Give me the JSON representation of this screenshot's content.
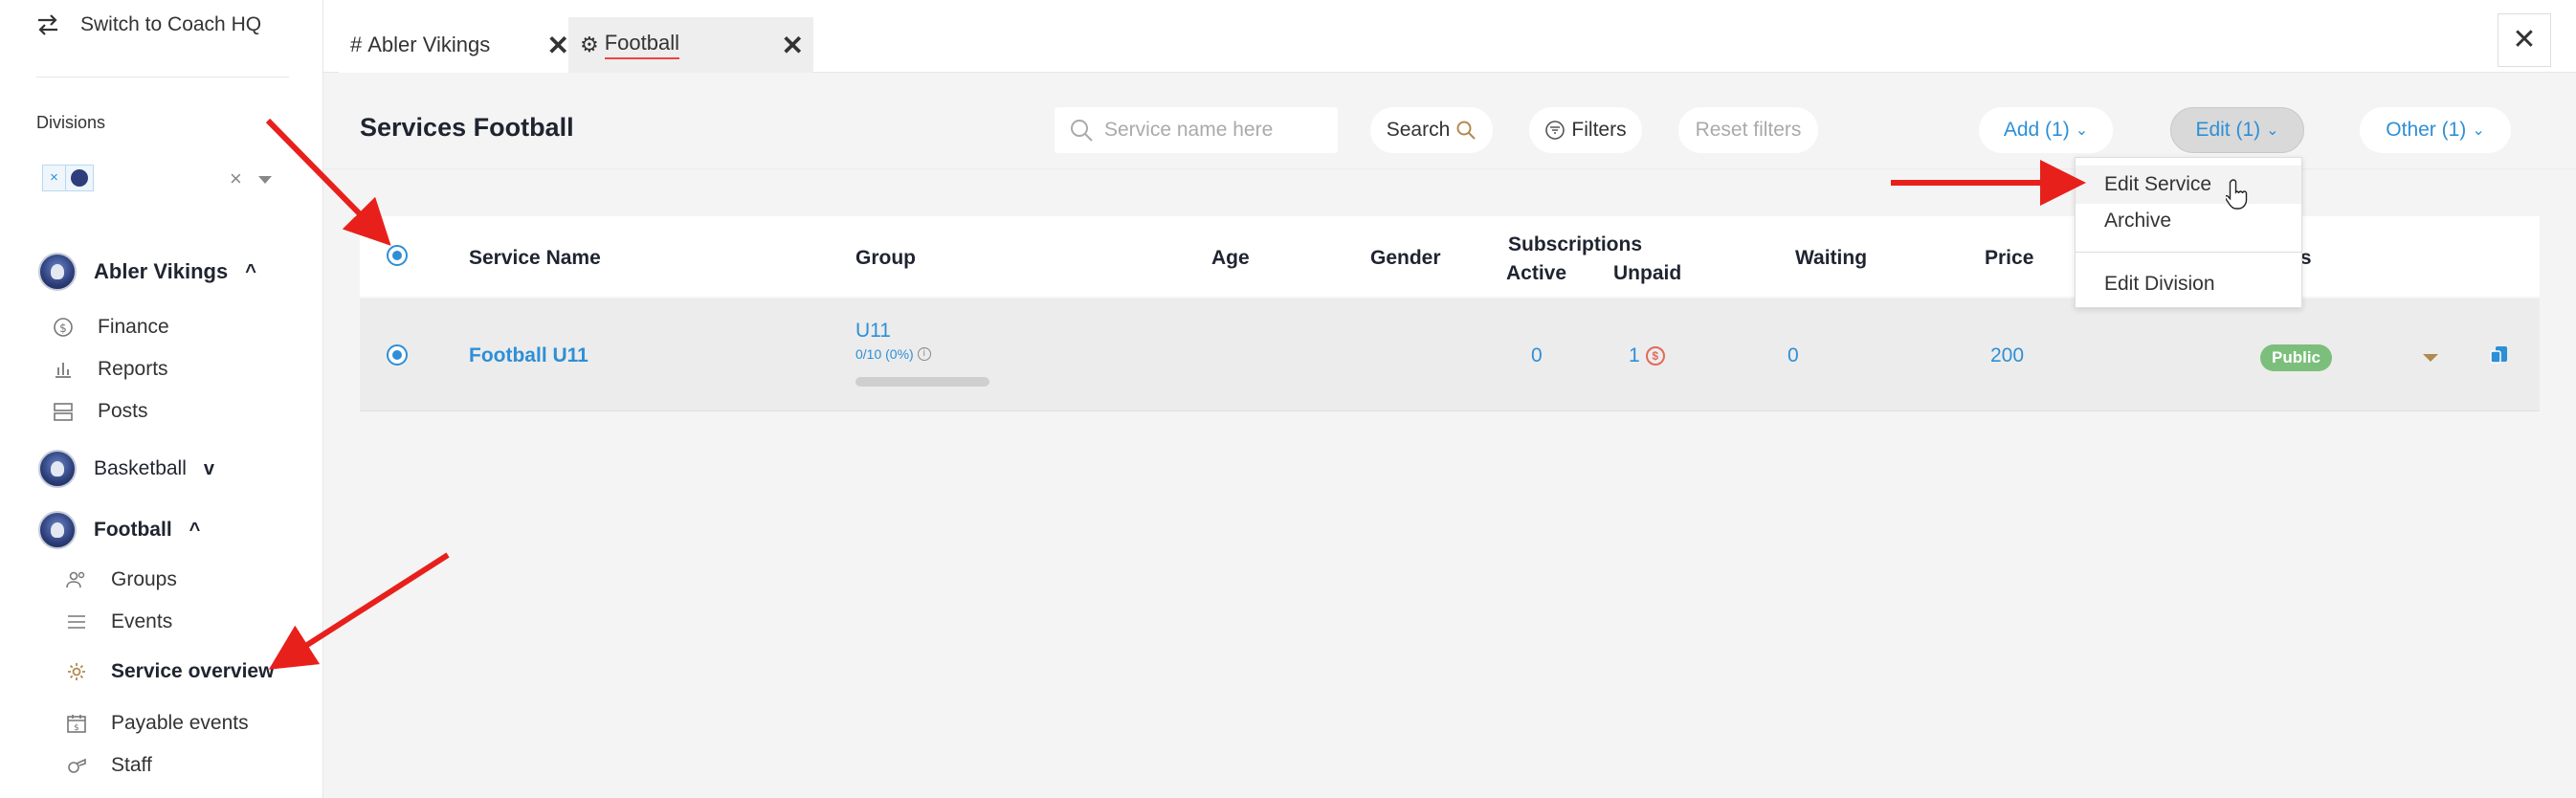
{
  "sidebar": {
    "switch_label": "Switch to Coach HQ",
    "divisions_label": "Divisions",
    "chip_remove": "×",
    "clear": "×",
    "clubs": [
      {
        "name": "Abler Vikings",
        "expanded": true
      },
      {
        "name": "Basketball",
        "expanded": false
      },
      {
        "name": "Football",
        "expanded": true
      }
    ],
    "club_items": [
      "Finance",
      "Reports",
      "Posts"
    ],
    "football_items": [
      "Groups",
      "Events",
      "Service overview",
      "Payable events",
      "Staff"
    ],
    "active_item": "Service overview"
  },
  "tabs": [
    {
      "label": "Abler Vikings",
      "icon": "hash-icon"
    },
    {
      "label": "Football",
      "icon": "gear-icon",
      "active": true
    }
  ],
  "header": {
    "title": "Services Football",
    "search_placeholder": "Service name here",
    "search_button": "Search",
    "filters_button": "Filters",
    "reset_button": "Reset filters",
    "add_button": "Add  (1)",
    "edit_button": "Edit  (1)",
    "other_button": "Other  (1)"
  },
  "edit_menu": {
    "items": [
      "Edit Service",
      "Archive",
      "Edit Division"
    ],
    "hovered": "Edit Service"
  },
  "table": {
    "columns": {
      "service_name": "Service Name",
      "group": "Group",
      "age": "Age",
      "gender": "Gender",
      "subscriptions": "Subscriptions",
      "active": "Active",
      "unpaid": "Unpaid",
      "waiting": "Waiting",
      "price": "Price",
      "status": "tus"
    },
    "rows": [
      {
        "service_name": "Football U11",
        "group": "U11",
        "group_capacity": "0/10 (0%)",
        "group_fill": 0,
        "age": "",
        "gender": "",
        "active": "0",
        "unpaid": "1",
        "waiting": "0",
        "price": "200",
        "status": "Public"
      }
    ]
  },
  "colors": {
    "accent": "#2e8fd6",
    "badge_public": "#7cbf7c",
    "arrow": "#e8201c"
  }
}
